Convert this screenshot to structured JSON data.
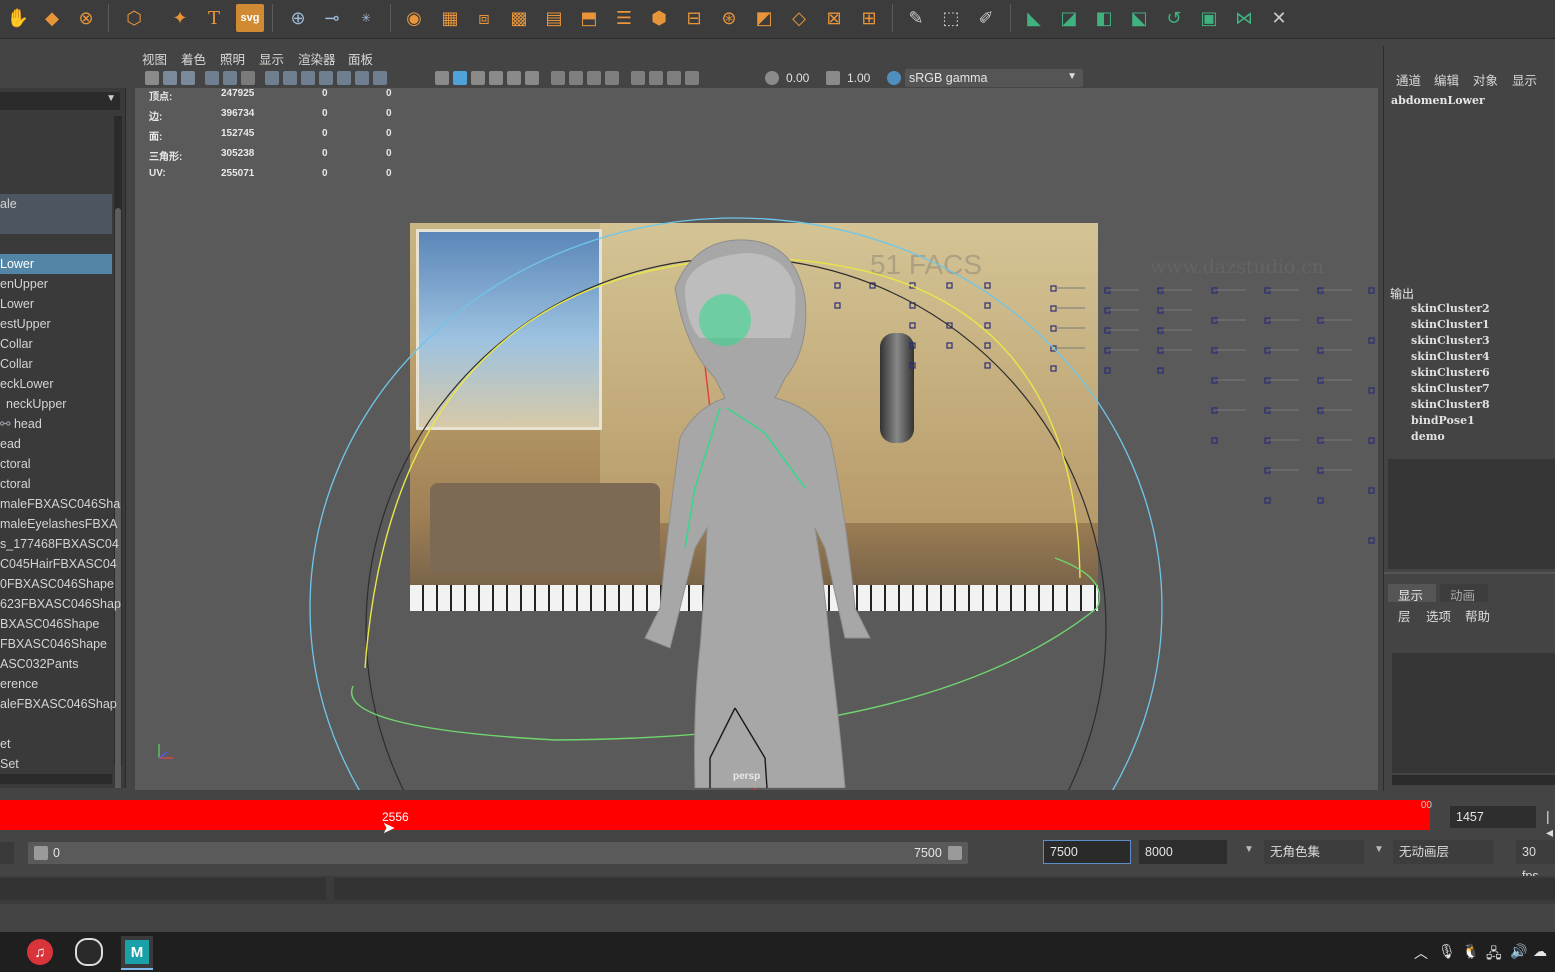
{
  "viewport_menu": [
    "视图",
    "着色",
    "照明",
    "显示",
    "渲染器",
    "面板"
  ],
  "viewport_toolbar": {
    "exposure": "0.00",
    "gamma": "1.00",
    "color_space": "sRGB gamma"
  },
  "heads_up": {
    "rows": [
      {
        "label": "顶点:",
        "v1": "247925",
        "v2": "0",
        "v3": "0"
      },
      {
        "label": "边:",
        "v1": "396734",
        "v2": "0",
        "v3": "0"
      },
      {
        "label": "面:",
        "v1": "152745",
        "v2": "0",
        "v3": "0"
      },
      {
        "label": "三角形:",
        "v1": "305238",
        "v2": "0",
        "v3": "0"
      },
      {
        "label": "UV:",
        "v1": "255071",
        "v2": "0",
        "v3": "0"
      }
    ],
    "camera": "persp"
  },
  "overlay_text": {
    "facs": "51 FACS",
    "watermark": "www.dazstudio.cn"
  },
  "outliner": {
    "items": [
      {
        "label": "ale"
      },
      {
        "label": "Lower",
        "selected": true
      },
      {
        "label": "enUpper"
      },
      {
        "label": "Lower"
      },
      {
        "label": "estUpper"
      },
      {
        "label": "Collar"
      },
      {
        "label": "Collar"
      },
      {
        "label": "eckLower"
      },
      {
        "label": "neckUpper"
      },
      {
        "label": "head"
      },
      {
        "label": "ead"
      },
      {
        "label": "ctoral"
      },
      {
        "label": "ctoral"
      },
      {
        "label": "maleFBXASC046Sha"
      },
      {
        "label": "maleEyelashesFBXA"
      },
      {
        "label": "s_177468FBXASC04"
      },
      {
        "label": "C045HairFBXASC04"
      },
      {
        "label": "0FBXASC046Shape"
      },
      {
        "label": "623FBXASC046Shap"
      },
      {
        "label": "BXASC046Shape"
      },
      {
        "label": "FBXASC046Shape"
      },
      {
        "label": "ASC032Pants"
      },
      {
        "label": "erence"
      },
      {
        "label": "aleFBXASC046Shap"
      },
      {
        "label": "et"
      },
      {
        "label": "Set"
      }
    ]
  },
  "channel_box": {
    "menu": [
      "通道",
      "编辑",
      "对象",
      "显示"
    ],
    "selected_node": "abdomenLower",
    "outputs_label": "输出",
    "outputs": [
      "skinCluster2",
      "skinCluster1",
      "skinCluster3",
      "skinCluster4",
      "skinCluster6",
      "skinCluster7",
      "skinCluster8",
      "bindPose1",
      "demo"
    ],
    "layer_tabs": [
      "显示",
      "动画"
    ],
    "layer_menu": [
      "层",
      "选项",
      "帮助"
    ]
  },
  "time_slider": {
    "current_frame": "2556",
    "end_mark": "00",
    "current_time_field": "1457"
  },
  "range_slider": {
    "start": "0",
    "range_end": "7500",
    "playback_end": "7500",
    "animation_end": "8000",
    "character_set": "无角色集",
    "anim_layer": "无动画层",
    "fps": "30 fps"
  },
  "colors": {
    "timeslider": "#ff0000",
    "selection": "#5285a6",
    "shelf_icon": "#e8953a"
  }
}
